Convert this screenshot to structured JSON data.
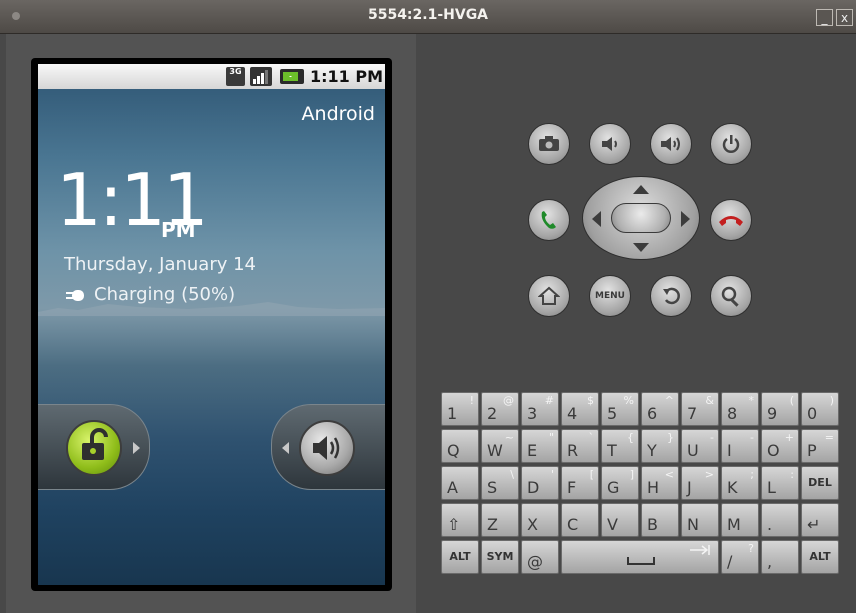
{
  "window": {
    "title": "5554:2.1-HVGA",
    "minimize": "_",
    "close": "x"
  },
  "status_bar": {
    "network": "3G",
    "time": "1:11 PM"
  },
  "lockscreen": {
    "carrier": "Android",
    "clock": "1:11",
    "ampm": "PM",
    "date": "Thursday, January 14",
    "charging": "Charging (50%)"
  },
  "controls": {
    "menu_label": "MENU",
    "buttons": [
      "camera-icon",
      "volume-down-icon",
      "volume-up-icon",
      "power-icon",
      "call-icon",
      "end-call-icon",
      "home-icon",
      "menu-icon",
      "back-icon",
      "search-icon"
    ]
  },
  "keyboard": {
    "rows": [
      [
        {
          "k": "1",
          "a": "!"
        },
        {
          "k": "2",
          "a": "@"
        },
        {
          "k": "3",
          "a": "#"
        },
        {
          "k": "4",
          "a": "$"
        },
        {
          "k": "5",
          "a": "%"
        },
        {
          "k": "6",
          "a": "^"
        },
        {
          "k": "7",
          "a": "&"
        },
        {
          "k": "8",
          "a": "*"
        },
        {
          "k": "9",
          "a": "("
        },
        {
          "k": "0",
          "a": ")"
        }
      ],
      [
        {
          "k": "Q",
          "a": ""
        },
        {
          "k": "W",
          "a": "~"
        },
        {
          "k": "E",
          "a": "\""
        },
        {
          "k": "R",
          "a": "`"
        },
        {
          "k": "T",
          "a": "{"
        },
        {
          "k": "Y",
          "a": "}"
        },
        {
          "k": "U",
          "a": "-"
        },
        {
          "k": "I",
          "a": "-"
        },
        {
          "k": "O",
          "a": "+"
        },
        {
          "k": "P",
          "a": "="
        }
      ],
      [
        {
          "k": "A",
          "a": ""
        },
        {
          "k": "S",
          "a": "\\"
        },
        {
          "k": "D",
          "a": "'"
        },
        {
          "k": "F",
          "a": "["
        },
        {
          "k": "G",
          "a": "]"
        },
        {
          "k": "H",
          "a": "<"
        },
        {
          "k": "J",
          "a": ">"
        },
        {
          "k": "K",
          "a": ";"
        },
        {
          "k": "L",
          "a": ":"
        },
        {
          "k": "DEL",
          "a": ""
        }
      ],
      [
        {
          "k": "⇧",
          "a": ""
        },
        {
          "k": "Z",
          "a": ""
        },
        {
          "k": "X",
          "a": ""
        },
        {
          "k": "C",
          "a": ""
        },
        {
          "k": "V",
          "a": ""
        },
        {
          "k": "B",
          "a": ""
        },
        {
          "k": "N",
          "a": ""
        },
        {
          "k": "M",
          "a": ""
        },
        {
          "k": ".",
          "a": ""
        },
        {
          "k": "↵",
          "a": ""
        }
      ]
    ],
    "bottom": {
      "alt_left": "ALT",
      "sym": "SYM",
      "at": "@",
      "slash": "/",
      "question": "?",
      "comma": ",",
      "alt_right": "ALT"
    }
  }
}
